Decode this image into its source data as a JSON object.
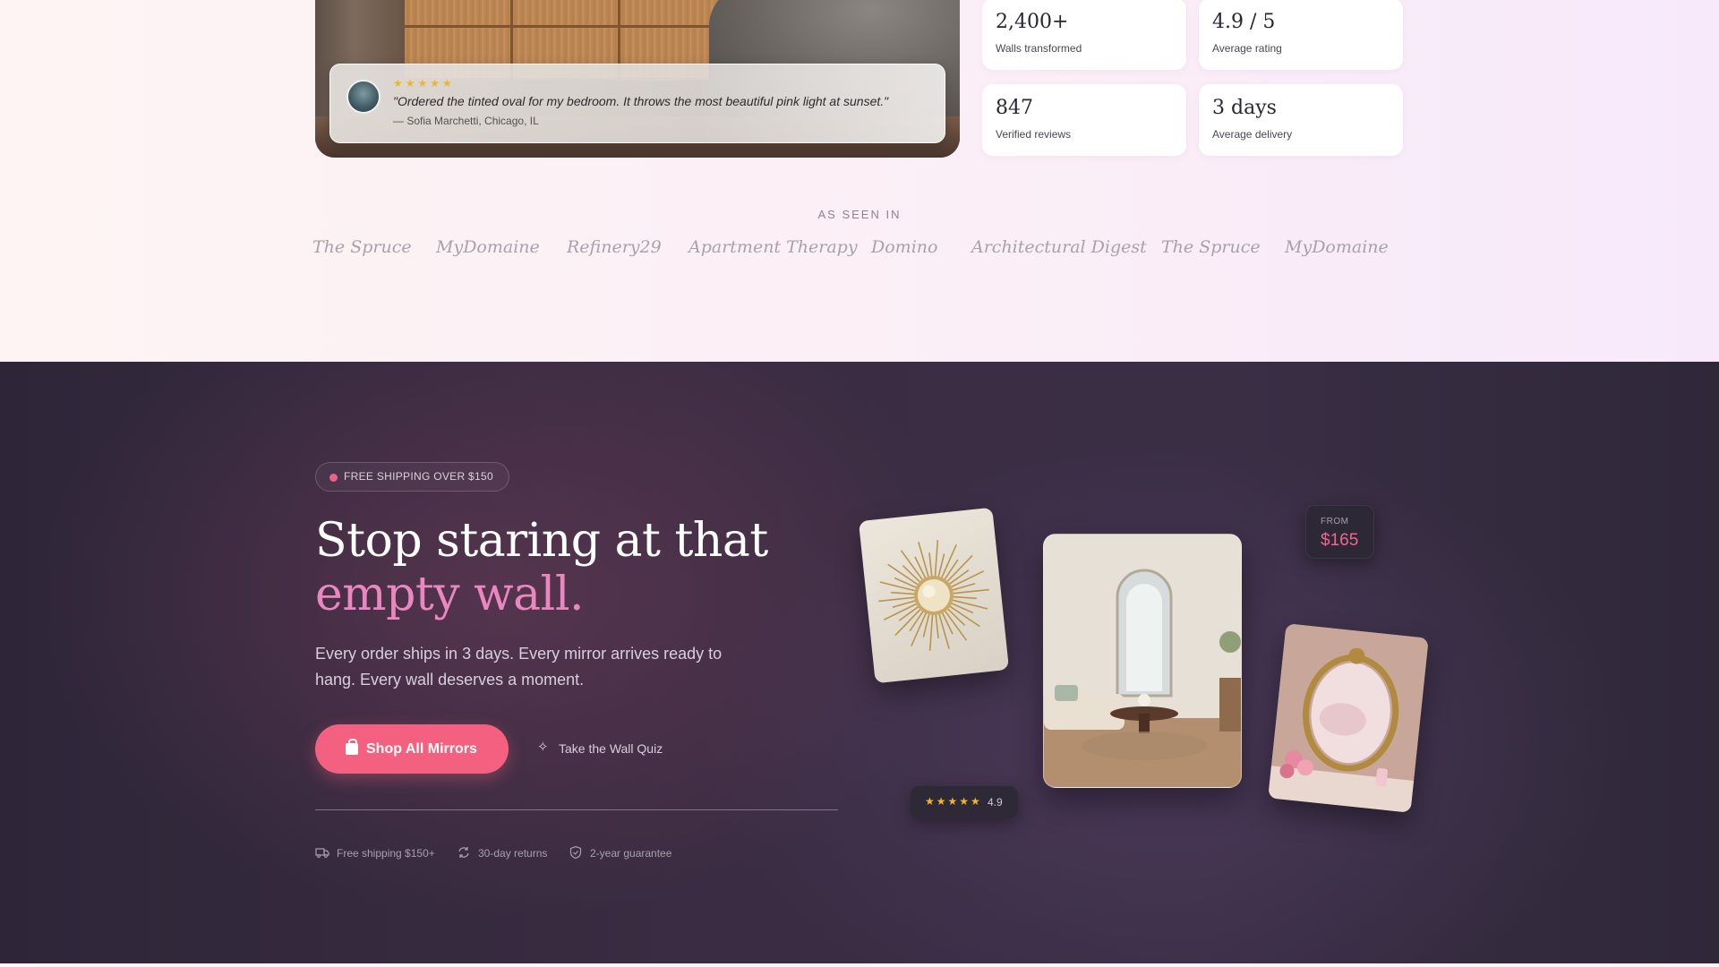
{
  "testimonial": {
    "stars": "★★★★★",
    "quote": "\"Ordered the tinted oval for my bedroom. It throws the most beautiful pink light at sunset.\"",
    "author": "— Sofia Marchetti, Chicago, IL"
  },
  "stats": [
    {
      "value": "2,400+",
      "label": "Walls transformed"
    },
    {
      "value": "4.9 / 5",
      "label": "Average rating"
    },
    {
      "value": "847",
      "label": "Verified reviews"
    },
    {
      "value": "3 days",
      "label": "Average delivery"
    }
  ],
  "press": {
    "label": "AS SEEN IN",
    "items": [
      "The Spruce",
      "MyDomaine",
      "Refinery29",
      "Apartment Therapy",
      "Domino",
      "Architectural Digest",
      "The Spruce",
      "MyDomaine"
    ]
  },
  "hero": {
    "badge": "FREE SHIPPING OVER $150",
    "headline_line1": "Stop staring at that",
    "headline_line2": "empty wall.",
    "subcopy": "Every order ships in 3 days. Every mirror arrives ready to hang. Every wall deserves a moment.",
    "primary_cta": "Shop All Mirrors",
    "secondary_cta": "Take the Wall Quiz",
    "trust": [
      "Free shipping $150+",
      "30-day returns",
      "2-year guarantee"
    ]
  },
  "showcase": {
    "price_from_label": "FROM",
    "price": "$165",
    "rating_stars": "★★★★★",
    "rating_value": "4.9"
  },
  "colors": {
    "accent_pink": "#f4607f",
    "headline_accent": "#eb87c0",
    "dark_bg": "#3a2c42",
    "star": "#f0b429"
  },
  "icons": [
    "bag-icon",
    "sparkle-icon",
    "truck-icon",
    "refresh-icon",
    "shield-icon",
    "star-icon"
  ]
}
